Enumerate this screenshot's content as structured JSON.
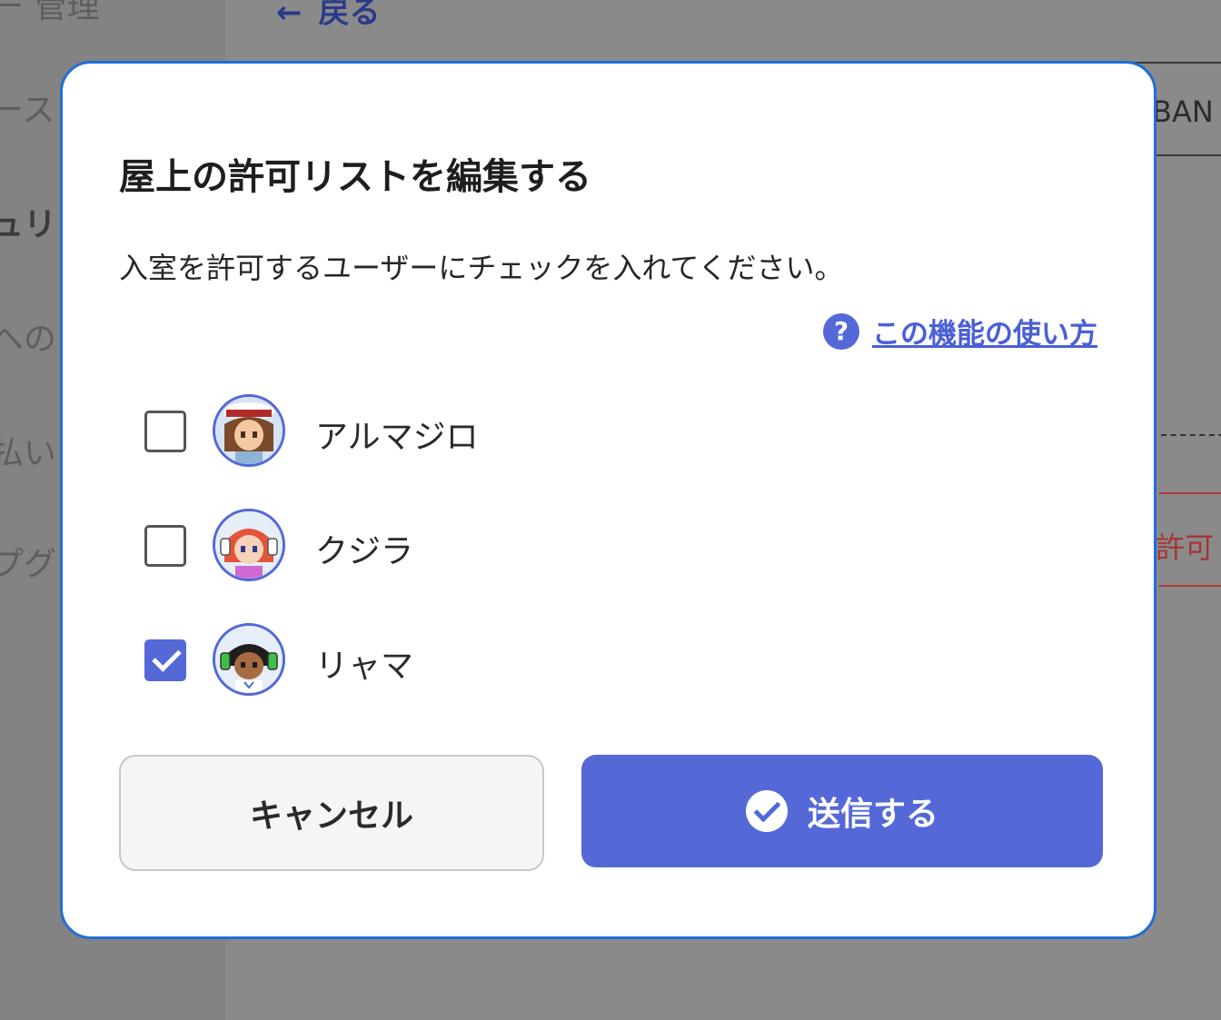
{
  "background": {
    "sidebar_items": [
      "ー 管理",
      "ース",
      "ュリ",
      "への",
      "払い",
      "プグ"
    ],
    "back_label": "戻る",
    "card_text": "BAN",
    "red_text": "許可"
  },
  "dialog": {
    "title": "屋上の許可リストを編集する",
    "description": "入室を許可するユーザーにチェックを入れてください。",
    "help_icon": "question-circle-icon",
    "help_link": "この機能の使い方",
    "users": [
      {
        "name": "アルマジロ",
        "checked": false
      },
      {
        "name": "クジラ",
        "checked": false
      },
      {
        "name": "リャマ",
        "checked": true
      }
    ],
    "cancel_label": "キャンセル",
    "submit_label": "送信する",
    "submit_icon": "check-circle-icon"
  },
  "colors": {
    "accent": "#5468d8",
    "dialog_border": "#1f6fd6",
    "overlay": "#8a8a8a"
  }
}
